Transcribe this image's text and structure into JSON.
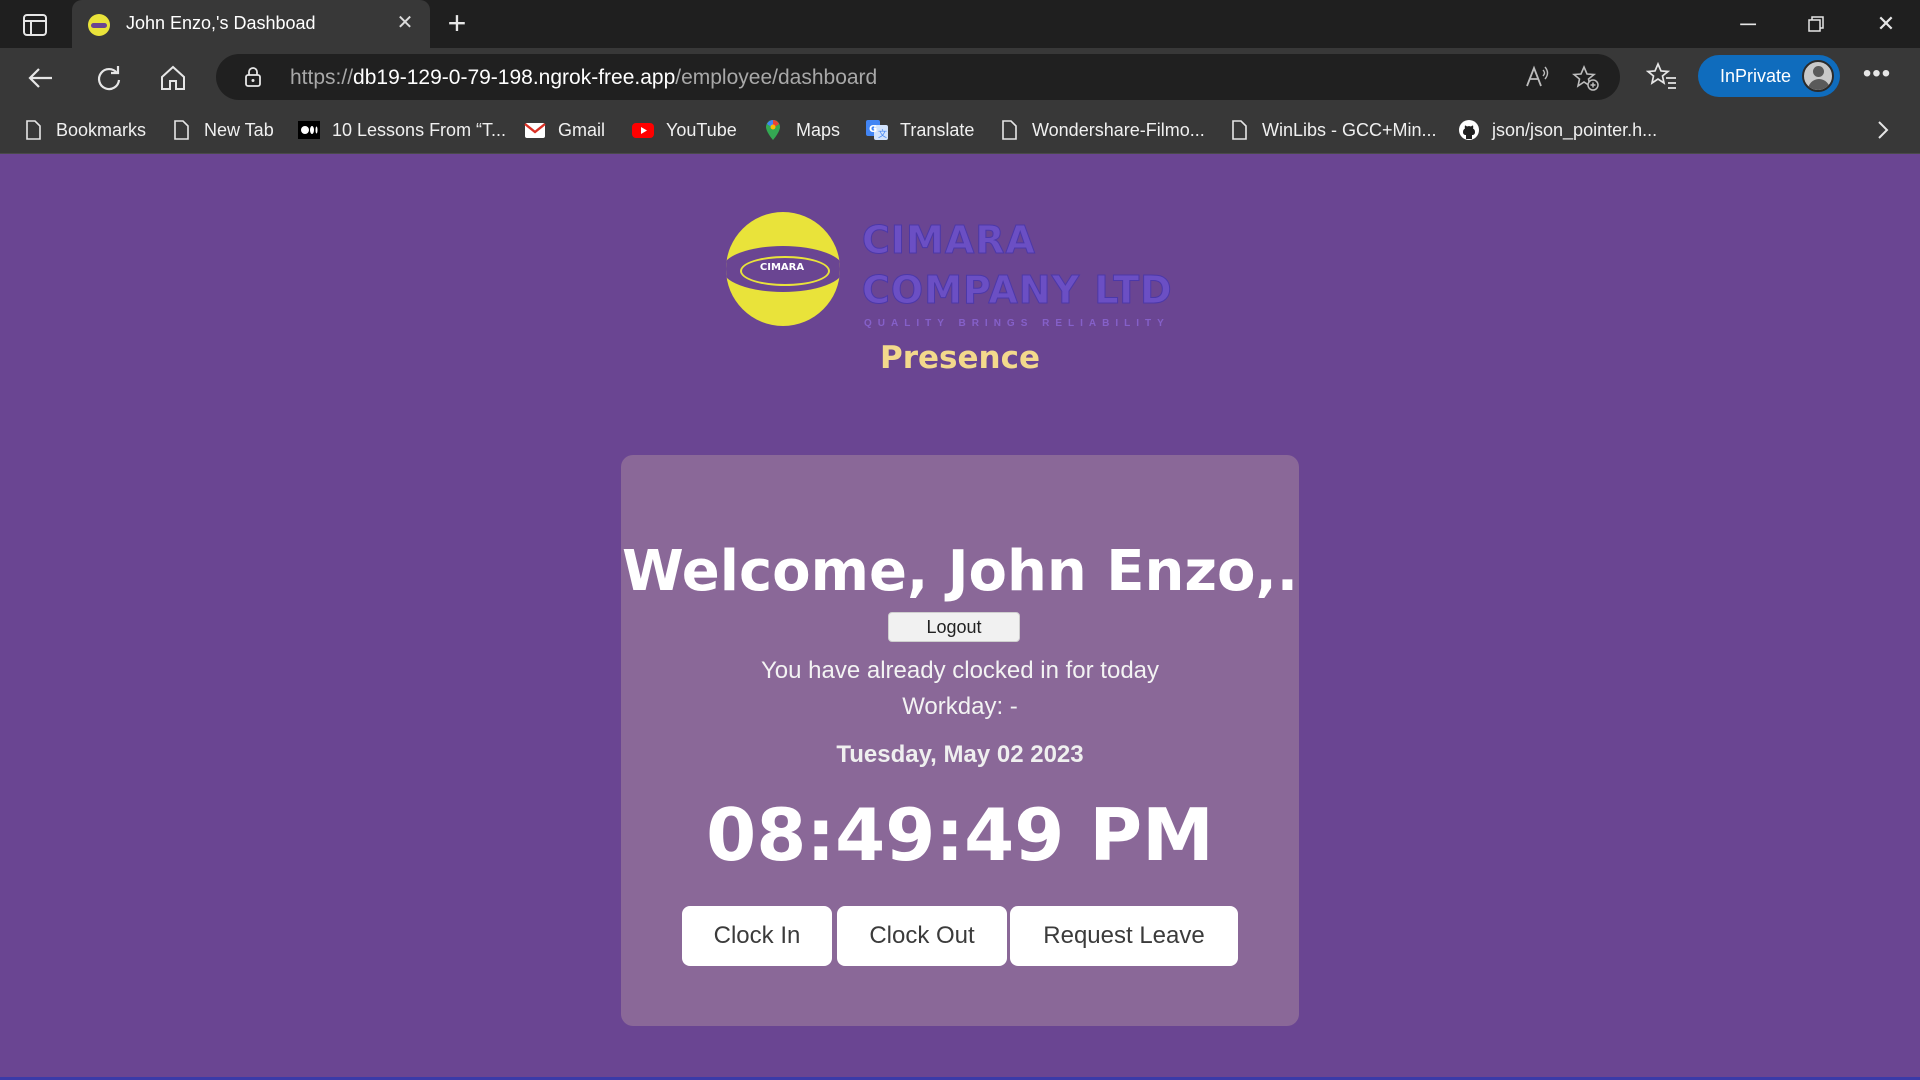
{
  "browser": {
    "tab_title": "John Enzo,'s Dashboad",
    "url_prefix": "https://",
    "url_host": "db19-129-0-79-198.ngrok-free.app",
    "url_path": "/employee/dashboard",
    "inprivate_label": "InPrivate",
    "accent_color": "#0f6cbd"
  },
  "bookmarks": [
    {
      "label": "Bookmarks",
      "icon": "page-icon"
    },
    {
      "label": "New Tab",
      "icon": "page-icon"
    },
    {
      "label": "10 Lessons From “T...",
      "icon": "medium-icon"
    },
    {
      "label": "Gmail",
      "icon": "gmail-icon"
    },
    {
      "label": "YouTube",
      "icon": "youtube-icon"
    },
    {
      "label": "Maps",
      "icon": "maps-pin-icon"
    },
    {
      "label": "Translate",
      "icon": "translate-icon"
    },
    {
      "label": "Wondershare-Filmo...",
      "icon": "page-icon"
    },
    {
      "label": "WinLibs - GCC+Min...",
      "icon": "page-icon"
    },
    {
      "label": "json/json_pointer.h...",
      "icon": "github-icon"
    }
  ],
  "page": {
    "logo": {
      "brand_line1": "CIMARA",
      "brand_line2": "COMPANY LTD",
      "tagline": "QUALITY BRINGS RELIABILITY",
      "emblem_text": "CIMARA"
    },
    "app_name": "Presence",
    "welcome": "Welcome, John Enzo,.",
    "logout_label": "Logout",
    "status_message": "You have already clocked in for today",
    "workday": "Workday: -",
    "date": "Tuesday, May 02 2023",
    "time": "08:49:49 PM",
    "buttons": {
      "clock_in": "Clock In",
      "clock_out": "Clock Out",
      "request_leave": "Request Leave"
    },
    "colors": {
      "background": "#6a4592",
      "card": "#8a6898",
      "presence_text": "#f3d98c",
      "logo_yellow": "#e9e33a"
    }
  }
}
